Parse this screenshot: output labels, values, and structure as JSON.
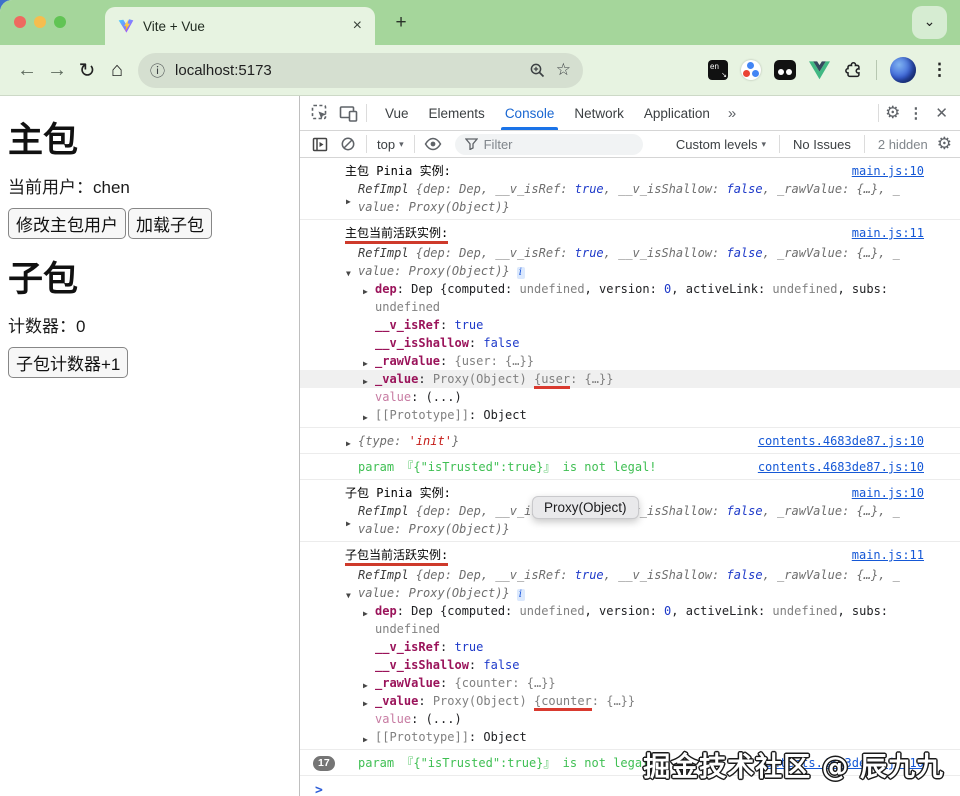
{
  "browser": {
    "tab_title": "Vite + Vue",
    "url": "localhost:5173"
  },
  "icons": {
    "back": "←",
    "forward": "→",
    "reload": "↻",
    "home": "⌂",
    "info": "ⓘ",
    "star": "☆",
    "plus": "+",
    "chevron_down": "⌄",
    "close_tab": "×",
    "gear": "⚙",
    "kebab": "⋮",
    "close": "✕",
    "more_tabs": "»",
    "caret": "▾",
    "collapsed_arrow": "▶",
    "expanded_arrow": "▼"
  },
  "page": {
    "title_main": "主包",
    "current_user": "当前用户：chen",
    "btn_modify_user": "修改主包用户",
    "btn_load_sub": "加载子包",
    "title_sub": "子包",
    "counter": "计数器：0",
    "btn_counter": "子包计数器+1"
  },
  "devtools": {
    "tabs": [
      "Vue",
      "Elements",
      "Console",
      "Network",
      "Application"
    ],
    "active_tab": "Console",
    "toolbar": {
      "context": "top",
      "filter_placeholder": "Filter",
      "custom_levels": "Custom levels",
      "no_issues": "No Issues",
      "hidden_count": "2 hidden"
    }
  },
  "tooltip": {
    "text": "Proxy(Object)"
  },
  "watermark": {
    "text": "掘金技术社区 @ 辰九九"
  },
  "console": {
    "prompt": ">",
    "entries": [
      {
        "label": "主包 Pinia 实例:",
        "redline": false,
        "link": "main.js:10",
        "rows": [
          {
            "a": "c",
            "prev": true,
            "i": 0,
            "lines": [
              [
                {
                  "s": "RefImpl ",
                  "c": "pn"
                },
                {
                  "s": "{dep: Dep, __v_isRef: ",
                  "c": "pd"
                },
                {
                  "s": "true",
                  "c": "pb"
                },
                {
                  "s": ", __v_isShallow: ",
                  "c": "pd"
                },
                {
                  "s": "false",
                  "c": "pb"
                },
                {
                  "s": ", _rawValue: {…}, _",
                  "c": "pd"
                }
              ],
              [
                {
                  "s": "value: Proxy(Object)}",
                  "c": "pd"
                }
              ]
            ]
          }
        ]
      },
      {
        "label": "主包当前活跃实例:",
        "redline": true,
        "link": "main.js:11",
        "rows": [
          {
            "a": "e",
            "prev": true,
            "info": true,
            "i": 0,
            "lines": [
              [
                {
                  "s": "RefImpl ",
                  "c": "pn"
                },
                {
                  "s": "{dep: Dep, __v_isRef: ",
                  "c": "pd"
                },
                {
                  "s": "true",
                  "c": "pb"
                },
                {
                  "s": ", __v_isShallow: ",
                  "c": "pd"
                },
                {
                  "s": "false",
                  "c": "pb"
                },
                {
                  "s": ", _rawValue: {…}, _",
                  "c": "pd"
                }
              ],
              [
                {
                  "s": "value: Proxy(Object)}",
                  "c": "pd"
                }
              ]
            ]
          },
          {
            "a": "c",
            "i": 1,
            "clip": true,
            "lines": [
              [
                {
                  "s": "dep",
                  "c": "k"
                },
                {
                  "s": ": Dep {computed: ",
                  "c": "t"
                },
                {
                  "s": "undefined",
                  "c": "d"
                },
                {
                  "s": ", version: ",
                  "c": "t"
                },
                {
                  "s": "0",
                  "c": "b"
                },
                {
                  "s": ", activeLink: ",
                  "c": "t"
                },
                {
                  "s": "undefined",
                  "c": "d"
                },
                {
                  "s": ", subs: ",
                  "c": "t"
                },
                {
                  "s": "undefined",
                  "c": "d"
                }
              ]
            ]
          },
          {
            "i": 1,
            "lines": [
              [
                {
                  "s": "__v_isRef",
                  "c": "k"
                },
                {
                  "s": ": ",
                  "c": "t"
                },
                {
                  "s": "true",
                  "c": "b"
                }
              ]
            ]
          },
          {
            "i": 1,
            "lines": [
              [
                {
                  "s": "__v_isShallow",
                  "c": "k"
                },
                {
                  "s": ": ",
                  "c": "t"
                },
                {
                  "s": "false",
                  "c": "b"
                }
              ]
            ]
          },
          {
            "a": "c",
            "i": 1,
            "lines": [
              [
                {
                  "s": "_rawValue",
                  "c": "k"
                },
                {
                  "s": ": ",
                  "c": "t"
                },
                {
                  "s": "{user: {…}}",
                  "c": "d"
                }
              ]
            ]
          },
          {
            "a": "c",
            "i": 1,
            "hl": true,
            "lines": [
              [
                {
                  "s": "_value",
                  "c": "k"
                },
                {
                  "s": ": ",
                  "c": "t"
                },
                {
                  "s": "Proxy(Object) ",
                  "c": "d"
                },
                {
                  "s": "{user",
                  "c": "d rul"
                },
                {
                  "s": ": {…}}",
                  "c": "d"
                }
              ]
            ]
          },
          {
            "i": 1,
            "lines": [
              [
                {
                  "s": "value",
                  "c": "kd"
                },
                {
                  "s": ": ",
                  "c": "t"
                },
                {
                  "s": "(...)",
                  "c": "t"
                }
              ]
            ]
          },
          {
            "a": "c",
            "i": 1,
            "lines": [
              [
                {
                  "s": "[[Prototype]]",
                  "c": "d"
                },
                {
                  "s": ": ",
                  "c": "t"
                },
                {
                  "s": "Object",
                  "c": "t"
                }
              ]
            ]
          }
        ]
      },
      {
        "link": "contents.4683de87.js:10",
        "rows": [
          {
            "a": "c",
            "prev": true,
            "i": 0,
            "lines": [
              [
                {
                  "s": "{",
                  "c": "pd"
                },
                {
                  "s": "type: ",
                  "c": "pd"
                },
                {
                  "s": "'init'",
                  "c": "ps"
                },
                {
                  "s": "}",
                  "c": "pd"
                }
              ]
            ]
          }
        ]
      },
      {
        "link": "contents.4683de87.js:10",
        "rows": [
          {
            "i": 0,
            "lines": [
              [
                {
                  "s": "param 『{\"isTrusted\":true}』 is not legal!",
                  "c": "g"
                }
              ]
            ]
          }
        ]
      },
      {
        "label": "子包 Pinia 实例:",
        "redline": false,
        "link": "main.js:10",
        "rows": [
          {
            "a": "c",
            "prev": true,
            "i": 0,
            "lines": [
              [
                {
                  "s": "RefImpl ",
                  "c": "pn"
                },
                {
                  "s": "{dep: Dep, __v_isRef: ",
                  "c": "pd"
                },
                {
                  "s": "true",
                  "c": "pb"
                },
                {
                  "s": ", __v_isShallow: ",
                  "c": "pd"
                },
                {
                  "s": "false",
                  "c": "pb"
                },
                {
                  "s": ", _rawValue: {…}, _",
                  "c": "pd"
                }
              ],
              [
                {
                  "s": "value: Proxy(Object)}",
                  "c": "pd"
                }
              ]
            ]
          }
        ]
      },
      {
        "label": "子包当前活跃实例:",
        "redline": true,
        "link": "main.js:11",
        "rows": [
          {
            "a": "e",
            "prev": true,
            "info": true,
            "i": 0,
            "lines": [
              [
                {
                  "s": "RefImpl ",
                  "c": "pn"
                },
                {
                  "s": "{dep: Dep, __v_isRef: ",
                  "c": "pd"
                },
                {
                  "s": "true",
                  "c": "pb"
                },
                {
                  "s": ", __v_isShallow: ",
                  "c": "pd"
                },
                {
                  "s": "false",
                  "c": "pb"
                },
                {
                  "s": ", _rawValue: {…}, _",
                  "c": "pd"
                }
              ],
              [
                {
                  "s": "value: Proxy(Object)}",
                  "c": "pd"
                }
              ]
            ]
          },
          {
            "a": "c",
            "i": 1,
            "clip": true,
            "lines": [
              [
                {
                  "s": "dep",
                  "c": "k"
                },
                {
                  "s": ": Dep {computed: ",
                  "c": "t"
                },
                {
                  "s": "undefined",
                  "c": "d"
                },
                {
                  "s": ", version: ",
                  "c": "t"
                },
                {
                  "s": "0",
                  "c": "b"
                },
                {
                  "s": ", activeLink: ",
                  "c": "t"
                },
                {
                  "s": "undefined",
                  "c": "d"
                },
                {
                  "s": ", subs: ",
                  "c": "t"
                },
                {
                  "s": "undefined",
                  "c": "d"
                }
              ]
            ]
          },
          {
            "i": 1,
            "lines": [
              [
                {
                  "s": "__v_isRef",
                  "c": "k"
                },
                {
                  "s": ": ",
                  "c": "t"
                },
                {
                  "s": "true",
                  "c": "b"
                }
              ]
            ]
          },
          {
            "i": 1,
            "lines": [
              [
                {
                  "s": "__v_isShallow",
                  "c": "k"
                },
                {
                  "s": ": ",
                  "c": "t"
                },
                {
                  "s": "false",
                  "c": "b"
                }
              ]
            ]
          },
          {
            "a": "c",
            "i": 1,
            "lines": [
              [
                {
                  "s": "_rawValue",
                  "c": "k"
                },
                {
                  "s": ": ",
                  "c": "t"
                },
                {
                  "s": "{counter: {…}}",
                  "c": "d"
                }
              ]
            ]
          },
          {
            "a": "c",
            "i": 1,
            "lines": [
              [
                {
                  "s": "_value",
                  "c": "k"
                },
                {
                  "s": ": ",
                  "c": "t"
                },
                {
                  "s": "Proxy(Object) ",
                  "c": "d"
                },
                {
                  "s": "{counter",
                  "c": "d rul"
                },
                {
                  "s": ": {…}}",
                  "c": "d"
                }
              ]
            ]
          },
          {
            "i": 1,
            "lines": [
              [
                {
                  "s": "value",
                  "c": "kd"
                },
                {
                  "s": ": ",
                  "c": "t"
                },
                {
                  "s": "(...)",
                  "c": "t"
                }
              ]
            ]
          },
          {
            "a": "c",
            "i": 1,
            "lines": [
              [
                {
                  "s": "[[Prototype]]",
                  "c": "d"
                },
                {
                  "s": ": ",
                  "c": "t"
                },
                {
                  "s": "Object",
                  "c": "t"
                }
              ]
            ]
          }
        ]
      },
      {
        "badge": "17",
        "link": "contents.4683de87.js:10",
        "rows": [
          {
            "i": 0,
            "lines": [
              [
                {
                  "s": "param 『{\"isTrusted\":true}』 is not legal!",
                  "c": "g"
                }
              ]
            ]
          }
        ]
      }
    ]
  }
}
